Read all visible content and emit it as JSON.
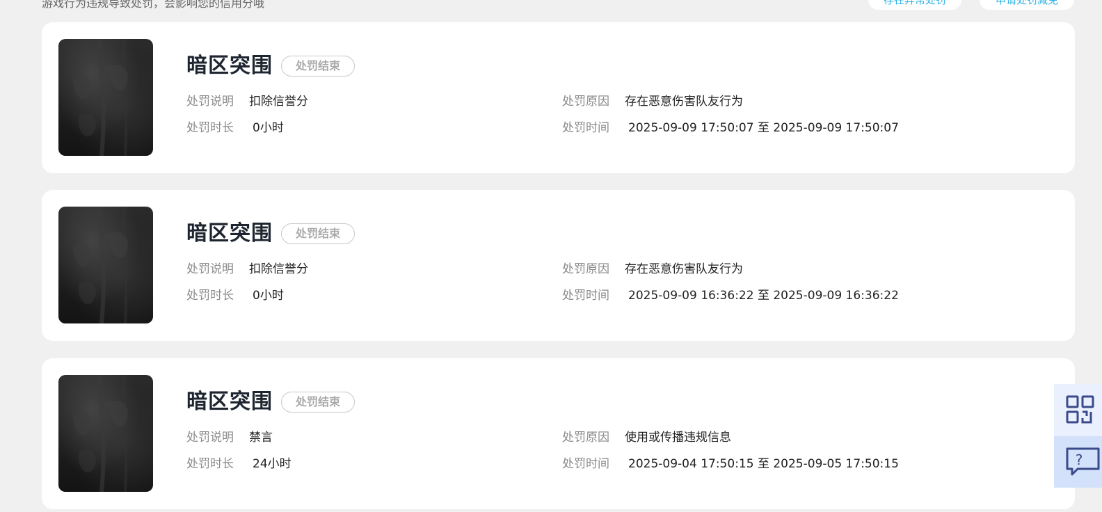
{
  "top_bar": {
    "hint": "游戏行为违规导致处罚，会影响您的信用分哦",
    "appeal_button": "存在异常处罚",
    "apply_button": "申请处罚减免"
  },
  "labels": {
    "desc": "处罚说明",
    "reason": "处罚原因",
    "duration": "处罚时长",
    "time": "处罚时间"
  },
  "records": [
    {
      "game": "暗区突围",
      "status": "处罚结束",
      "desc": "扣除信誉分",
      "reason": "存在恶意伤害队友行为",
      "duration": "0小时",
      "time": "2025-09-09 17:50:07 至 2025-09-09 17:50:07"
    },
    {
      "game": "暗区突围",
      "status": "处罚结束",
      "desc": "扣除信誉分",
      "reason": "存在恶意伤害队友行为",
      "duration": "0小时",
      "time": "2025-09-09 16:36:22 至 2025-09-09 16:36:22"
    },
    {
      "game": "暗区突围",
      "status": "处罚结束",
      "desc": "禁言",
      "reason": "使用或传播违规信息",
      "duration": "24小时",
      "time": "2025-09-04 17:50:15 至 2025-09-05 17:50:15"
    }
  ],
  "float_panel": {
    "qr_icon": "qr-code-icon",
    "help_icon": "help-chat-icon",
    "accent": "#3a4a8a"
  }
}
